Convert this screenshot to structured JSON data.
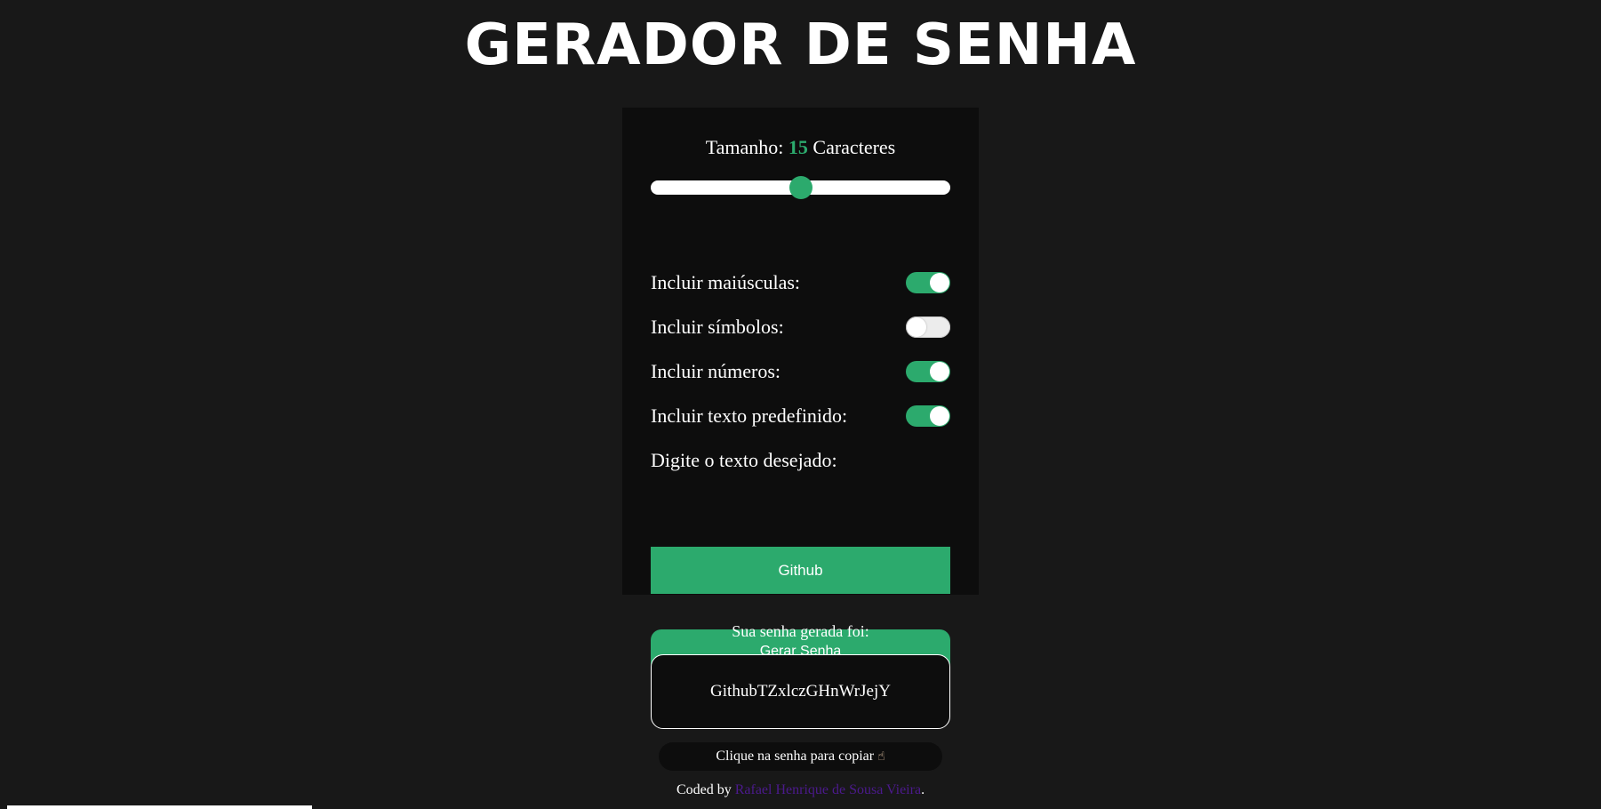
{
  "header": {
    "title": "GERADOR DE SENHA"
  },
  "generator": {
    "size_prefix": "Tamanho:",
    "size_value": "15",
    "size_suffix": "Caracteres",
    "slider_fraction": 0.5,
    "options": [
      {
        "label": "Incluir maiúsculas:",
        "enabled": true
      },
      {
        "label": "Incluir símbolos:",
        "enabled": false
      },
      {
        "label": "Incluir números:",
        "enabled": true
      },
      {
        "label": "Incluir texto predefinido:",
        "enabled": true
      }
    ],
    "text_label": "Digite o texto desejado:",
    "text_value": "Github",
    "generate_label": "Gerar Senha"
  },
  "result": {
    "label": "Sua senha gerada foi:",
    "password": "GithubTZxlczGHnWrJejY",
    "copy_hint": "Clique na senha para copiar",
    "copy_icon": "pointing-hand-icon"
  },
  "footer": {
    "prefix": "Coded by",
    "author": "Rafael Henrique de Sousa Vieira",
    "suffix": "."
  },
  "colors": {
    "background": "#181818",
    "panel": "#0d0d0d",
    "accent": "#2caa6d",
    "link": "#4b1a8c"
  }
}
